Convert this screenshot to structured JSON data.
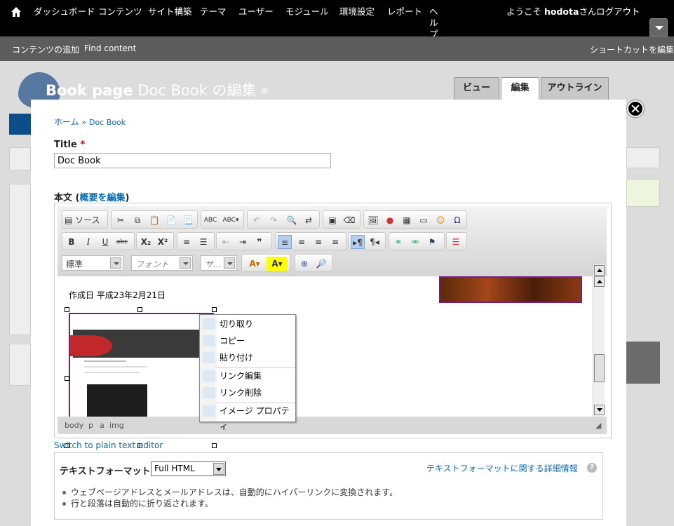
{
  "toolbar": {
    "menu": [
      "ダッシュボード",
      "コンテンツ",
      "サイト構築",
      "テーマ",
      "ユーザー",
      "モジュール",
      "環境設定",
      "レポート",
      "ヘルプ"
    ],
    "welcome_prefix": "ようこそ",
    "username": "hodota",
    "welcome_suffix": "さん",
    "logout": "ログアウト"
  },
  "shortcuts": {
    "add_content": "コンテンツの追加",
    "find_content": "Find content",
    "edit_shortcuts": "ショートカットを編集"
  },
  "page": {
    "title_bold": "Book page",
    "title_rest": "Doc Book の編集",
    "tabs": [
      "ビュー",
      "編集",
      "アウトライン"
    ],
    "active_tab": "編集"
  },
  "breadcrumb": {
    "home": "ホーム",
    "sep": "»",
    "current": "Doc Book"
  },
  "form": {
    "title_label": "Title",
    "required_mark": "*",
    "title_value": "Doc Book",
    "body_label": "本文",
    "summary_link": "概要を編集",
    "switch_link": "Switch to plain text editor"
  },
  "editor": {
    "source_label": "ソース",
    "format_combo": "標準",
    "font_combo": "フォント",
    "size_combo": "サ...",
    "content_date": "作成日 平成23年2月21日",
    "status_path": [
      "body",
      "p",
      "a",
      "img"
    ]
  },
  "context_menu": {
    "items": [
      "切り取り",
      "コピー",
      "貼り付け",
      "リンク編集",
      "リンク削除",
      "イメージ プロパティ"
    ]
  },
  "text_format": {
    "label": "テキストフォーマット",
    "selected": "Full HTML",
    "more_info": "テキストフォーマットに関する詳細情報",
    "tips": [
      "ウェブページアドレスとメールアドレスは、自動的にハイパーリンクに変換されます。",
      "行と段落は自動的に折り返されます。"
    ]
  }
}
